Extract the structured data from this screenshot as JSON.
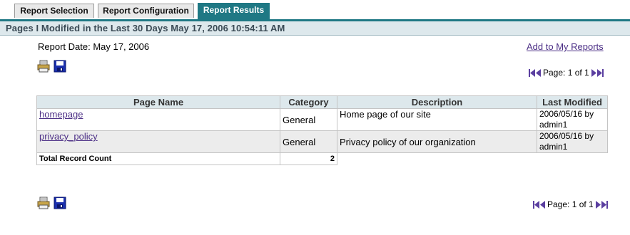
{
  "tabs": [
    {
      "label": "Report Selection",
      "active": false
    },
    {
      "label": "Report Configuration",
      "active": false
    },
    {
      "label": "Report Results",
      "active": true
    }
  ],
  "header": {
    "title": "Pages I Modified in the Last 30 Days May 17, 2006 10:54:11 AM"
  },
  "report": {
    "date_label": "Report Date: May 17, 2006",
    "add_link": "Add to My Reports"
  },
  "pager": {
    "text": "Page: 1 of 1"
  },
  "table": {
    "headers": [
      "Page Name",
      "Category",
      "Description",
      "Last Modified"
    ],
    "rows": [
      {
        "name": "homepage",
        "category": "General",
        "description": "Home page of our site",
        "modified_date": "2006/05/16 by",
        "modified_by": "admin1"
      },
      {
        "name": "privacy_policy",
        "category": "General",
        "description": "Privacy policy of our organization",
        "modified_date": "2006/05/16 by",
        "modified_by": "admin1"
      }
    ],
    "total_label": "Total Record Count",
    "total_value": "2"
  },
  "icons": [
    "print-icon",
    "save-icon",
    "first-page-icon",
    "previous-page-icon",
    "next-page-icon",
    "last-page-icon"
  ],
  "colors": {
    "accent": "#1f7884",
    "header_band": "#dde8ec",
    "link": "#4c2f86",
    "pager_arrow": "#5b3fa0"
  }
}
